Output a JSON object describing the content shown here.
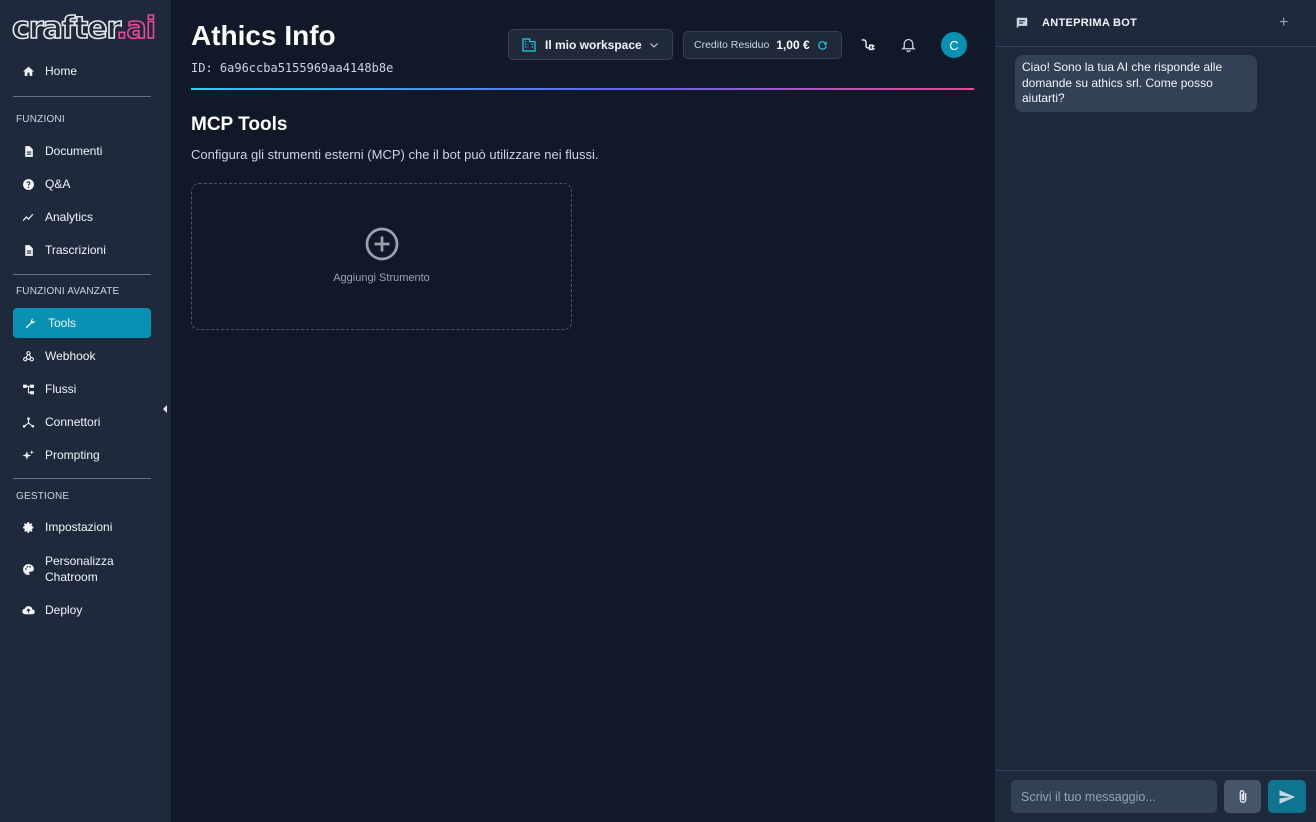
{
  "app": {
    "logo_text": "crafter",
    "logo_suffix": ".ai"
  },
  "sidebar": {
    "home": "Home",
    "sections": [
      "FUNZIONI",
      "FUNZIONI AVANZATE",
      "GESTIONE"
    ],
    "funzioni": [
      "Documenti",
      "Q&A",
      "Analytics",
      "Trascrizioni"
    ],
    "avanzate": [
      "Tools",
      "Webhook",
      "Flussi",
      "Connettori",
      "Prompting"
    ],
    "gestione": [
      "Impostazioni",
      "Personalizza Chatroom",
      "Deploy"
    ],
    "active_item": "Tools"
  },
  "header": {
    "title": "Athics Info",
    "id_text": "ID: 6a96ccba5155969aa4148b8e",
    "workspace_label": "Il mio workspace",
    "credit_label": "Credito Residuo",
    "credit_value": "1,00 €",
    "avatar_initial": "C"
  },
  "main": {
    "section_title": "MCP Tools",
    "section_desc": "Configura gli strumenti esterni (MCP) che il bot può utilizzare nei flussi.",
    "add_tool_label": "Aggiungi Strumento"
  },
  "panel": {
    "title": "ANTEPRIMA BOT",
    "plus_label": "+",
    "bot_message": "Ciao! Sono la tua AI che risponde alle domande su athics srl. Come posso aiutarti?",
    "input_placeholder": "Scrivi il tuo messaggio..."
  },
  "colors": {
    "accent": "#0891b2",
    "sidebar_bg": "#1e293b",
    "main_bg": "#111827",
    "logo_accent": "#ec4899"
  }
}
